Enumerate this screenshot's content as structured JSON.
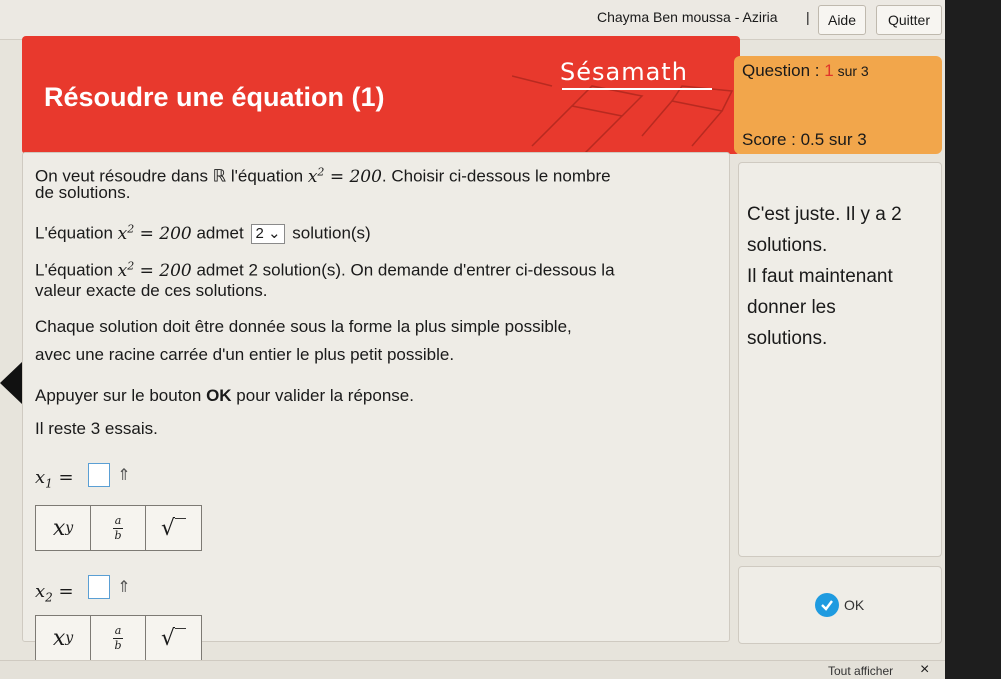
{
  "topbar": {
    "user_name": "Chayma Ben moussa - Aziria",
    "separator": "|",
    "aide_label": "Aide",
    "quitter_label": "Quitter"
  },
  "header": {
    "title": "Résoudre une équation (1)",
    "logo": "Sésamath"
  },
  "question_panel": {
    "label": "Question : ",
    "current": "1",
    "total": " sur 3",
    "score": "Score : 0.5 sur 3"
  },
  "main": {
    "intro_1a": "On veut résoudre dans ℝ l'équation ",
    "intro_eq": "x",
    "intro_exp": "2",
    "intro_rhs": " = 200",
    "intro_1b": ". Choisir ci-dessous le nombre",
    "intro_2": "de solutions.",
    "line_admet_a": "L'équation ",
    "line_admet_b": " admet",
    "select_value": "2",
    "line_admet_c": "solution(s)",
    "line_admet2_a": "L'équation ",
    "line_admet2_b": " admet 2 solution(s). On demande d'entrer ci-dessous la",
    "line_admet2_c": "valeur exacte de ces solutions.",
    "instr_1": "Chaque solution doit être donnée sous la forme la plus simple possible,",
    "instr_2": "avec une racine carrée d'un entier le plus petit possible.",
    "ok_instr_a": "Appuyer sur le bouton ",
    "ok_instr_b": "OK",
    "ok_instr_c": " pour valider la réponse.",
    "essais": "Il reste 3 essais.",
    "x1_label": "x",
    "x1_sub": "1",
    "x2_label": "x",
    "x2_sub": "2",
    "equals": "="
  },
  "mathbar": {
    "pow_base": "x",
    "pow_exp": "y",
    "frac_num": "a",
    "frac_den": "b",
    "sqrt": "√‾"
  },
  "feedback": {
    "lines": [
      "C'est juste. Il y a 2",
      "solutions.",
      "Il faut maintenant",
      "donner les",
      "solutions."
    ]
  },
  "ok_button": {
    "label": "OK"
  },
  "footer": {
    "tout_afficher": "Tout afficher",
    "close": "×"
  },
  "colors": {
    "header_red": "#e8392d",
    "panel_orange": "#f2a64b",
    "ok_blue": "#1f9be0"
  }
}
